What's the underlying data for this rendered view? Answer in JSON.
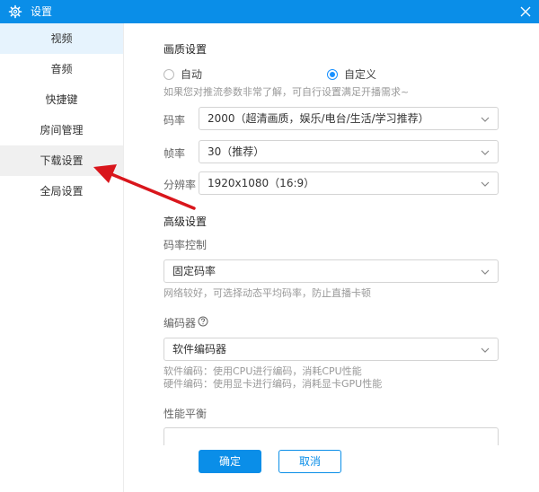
{
  "window": {
    "title": "设置"
  },
  "colors": {
    "accent": "#0a8ee8",
    "radio": "#1890ff",
    "arrow": "#d9161c"
  },
  "sidebar": {
    "items": [
      {
        "label": "视频"
      },
      {
        "label": "音频"
      },
      {
        "label": "快捷键"
      },
      {
        "label": "房间管理"
      },
      {
        "label": "下载设置"
      },
      {
        "label": "全局设置"
      }
    ]
  },
  "quality": {
    "title": "画质设置",
    "radio_auto": "自动",
    "radio_custom": "自定义",
    "hint": "如果您对推流参数非常了解，可自行设置满足开播需求~",
    "bitrate": {
      "label": "码率",
      "value": "2000（超清画质，娱乐/电台/生活/学习推荐）"
    },
    "fps": {
      "label": "帧率",
      "value": "30（推荐）"
    },
    "resolution": {
      "label": "分辨率",
      "value": "1920x1080（16:9）"
    }
  },
  "advanced": {
    "title": "高级设置",
    "rate_control": {
      "label": "码率控制",
      "value": "固定码率",
      "hint": "网络较好，可选择动态平均码率，防止直播卡顿"
    },
    "encoder": {
      "label": "编码器",
      "value": "软件编码器",
      "hint1": "软件编码：使用CPU进行编码，消耗CPU性能",
      "hint2": "硬件编码：使用显卡进行编码，消耗显卡GPU性能"
    },
    "performance": {
      "label": "性能平衡"
    }
  },
  "footer": {
    "confirm": "确定",
    "cancel": "取消"
  }
}
